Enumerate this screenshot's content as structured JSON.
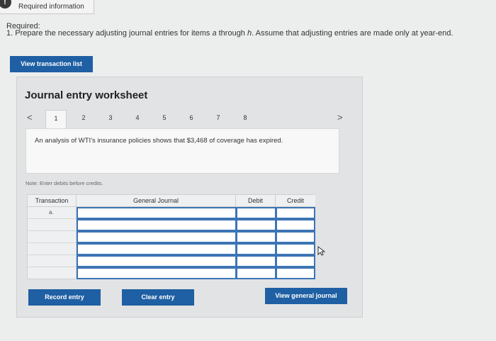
{
  "info_tab": {
    "label": "Required information",
    "badge": "!"
  },
  "required": {
    "label": "Required:",
    "text_prefix": "1. Prepare the necessary adjusting journal entries for items ",
    "item_a": "a",
    "text_middle": " through ",
    "item_h": "h",
    "text_suffix": ". Assume that adjusting entries are made only at year-end."
  },
  "view_list_button": "View transaction list",
  "worksheet": {
    "title": "Journal entry worksheet",
    "tabs": [
      "1",
      "2",
      "3",
      "4",
      "5",
      "6",
      "7",
      "8"
    ],
    "prev_arrow": "<",
    "next_arrow": ">",
    "description": "An analysis of WTI's insurance policies shows that $3,468 of coverage has expired.",
    "note": "Note: Enter debits before credits.",
    "table": {
      "headers": {
        "transaction": "Transaction",
        "general_journal": "General Journal",
        "debit": "Debit",
        "credit": "Credit"
      },
      "rows": [
        {
          "transaction": "a."
        },
        {
          "transaction": ""
        },
        {
          "transaction": ""
        },
        {
          "transaction": ""
        },
        {
          "transaction": ""
        },
        {
          "transaction": ""
        }
      ]
    },
    "buttons": {
      "record": "Record entry",
      "clear": "Clear entry",
      "view_general": "View general journal"
    }
  },
  "colors": {
    "accent_blue": "#1f5fa3",
    "input_border": "#3d74b5"
  },
  "icons": {
    "cursor": "mouse-pointer-icon"
  }
}
